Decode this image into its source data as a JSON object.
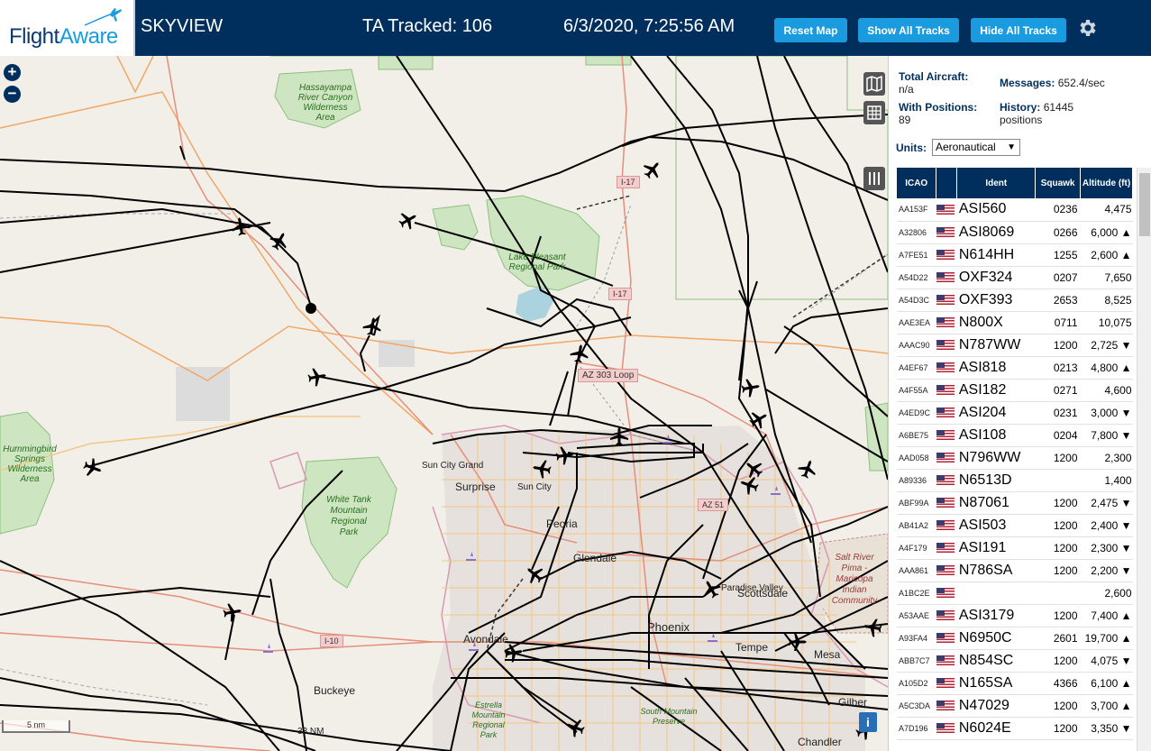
{
  "header": {
    "logo_flight": "Flight",
    "logo_aware": "Aware",
    "app_title": "SKYVIEW",
    "tracked": "TA Tracked: 106",
    "datetime": "6/3/2020, 7:25:56 AM",
    "reset_label": "Reset Map",
    "show_label": "Show All Tracks",
    "hide_label": "Hide All Tracks"
  },
  "colors": {
    "header_bg": "#002f5d",
    "button_bg": "#1a9be0",
    "park": "#cde6c1",
    "track": "#000000"
  },
  "map": {
    "zoom_in": "+",
    "zoom_out": "−",
    "scale_km": "5 nm",
    "scale_nm": "33 NM",
    "info": "i",
    "labels": [
      {
        "id": "hassayampa",
        "text": "Hassayampa River Canyon Wilderness Area"
      },
      {
        "id": "lake-pleasant",
        "text": "Lake Pleasant Regional Park"
      },
      {
        "id": "hummingbird",
        "text": "Hummingbird Springs Wilderness Area"
      },
      {
        "id": "white-tank",
        "text": "White Tank Mountain Regional Park"
      },
      {
        "id": "estrella",
        "text": "Estrella Mountain Regional Park"
      },
      {
        "id": "south-mountain",
        "text": "South Mountain Preserve"
      },
      {
        "id": "salt-river",
        "text": "Salt River Pima - Maricopa Indian Community"
      },
      {
        "id": "sun-city-grand",
        "text": "Sun City Grand"
      },
      {
        "id": "surprise",
        "text": "Surprise"
      },
      {
        "id": "sun-city",
        "text": "Sun City"
      },
      {
        "id": "peoria",
        "text": "Peoria"
      },
      {
        "id": "glendale",
        "text": "Glendale"
      },
      {
        "id": "paradise-valley",
        "text": "Paradise Valley"
      },
      {
        "id": "scottsdale",
        "text": "Scottsdale"
      },
      {
        "id": "phoenix",
        "text": "Phoenix"
      },
      {
        "id": "tempe",
        "text": "Tempe"
      },
      {
        "id": "mesa",
        "text": "Mesa"
      },
      {
        "id": "avondale",
        "text": "Avondale"
      },
      {
        "id": "buckeye",
        "text": "Buckeye"
      },
      {
        "id": "gilbert",
        "text": "Gilber"
      },
      {
        "id": "chandler",
        "text": "Chandler"
      },
      {
        "id": "i17",
        "text": "I-17"
      },
      {
        "id": "i17b",
        "text": "I-17"
      },
      {
        "id": "az303",
        "text": "AZ 303 Loop"
      },
      {
        "id": "az51",
        "text": "AZ 51"
      },
      {
        "id": "i10",
        "text": "I-10"
      }
    ]
  },
  "stats": {
    "total_label": "Total Aircraft:",
    "total_value": "n/a",
    "positions_label": "With Positions:",
    "positions_value": "89",
    "messages_label": "Messages:",
    "messages_value": "652.4/sec",
    "history_label": "History:",
    "history_value": "61445",
    "history_unit": "positions"
  },
  "units": {
    "label": "Units:",
    "selected": "Aeronautical"
  },
  "table": {
    "headers": {
      "icao": "ICAO",
      "ident": "Ident",
      "squawk": "Squawk",
      "altitude": "Altitude (ft)"
    },
    "rows": [
      {
        "icao": "AA153F",
        "ident": "ASI560",
        "squawk": "0236",
        "alt": "4,475"
      },
      {
        "icao": "A32806",
        "ident": "ASI8069",
        "squawk": "0266",
        "alt": "6,000 ▲"
      },
      {
        "icao": "A7FE51",
        "ident": "N614HH",
        "squawk": "1255",
        "alt": "2,600 ▲"
      },
      {
        "icao": "A54D22",
        "ident": "OXF324",
        "squawk": "0207",
        "alt": "7,650"
      },
      {
        "icao": "A54D3C",
        "ident": "OXF393",
        "squawk": "2653",
        "alt": "8,525"
      },
      {
        "icao": "AAE3EA",
        "ident": "N800X",
        "squawk": "0711",
        "alt": "10,075"
      },
      {
        "icao": "AAAC90",
        "ident": "N787WW",
        "squawk": "1200",
        "alt": "2,725 ▼"
      },
      {
        "icao": "A4EF67",
        "ident": "ASI818",
        "squawk": "0213",
        "alt": "4,800 ▲"
      },
      {
        "icao": "A4F55A",
        "ident": "ASI182",
        "squawk": "0271",
        "alt": "4,600"
      },
      {
        "icao": "A4ED9C",
        "ident": "ASI204",
        "squawk": "0231",
        "alt": "3,000 ▼"
      },
      {
        "icao": "A6BE75",
        "ident": "ASI108",
        "squawk": "0204",
        "alt": "7,800 ▼"
      },
      {
        "icao": "AAD058",
        "ident": "N796WW",
        "squawk": "1200",
        "alt": "2,300"
      },
      {
        "icao": "A89336",
        "ident": "N6513D",
        "squawk": "",
        "alt": "1,400"
      },
      {
        "icao": "ABF99A",
        "ident": "N87061",
        "squawk": "1200",
        "alt": "2,475 ▼"
      },
      {
        "icao": "AB41A2",
        "ident": "ASI503",
        "squawk": "1200",
        "alt": "2,400 ▼"
      },
      {
        "icao": "A4F179",
        "ident": "ASI191",
        "squawk": "1200",
        "alt": "2,300 ▼"
      },
      {
        "icao": "AAA861",
        "ident": "N786SA",
        "squawk": "1200",
        "alt": "2,200 ▼"
      },
      {
        "icao": "A1BC2E",
        "ident": "",
        "squawk": "",
        "alt": "2,600"
      },
      {
        "icao": "A53AAE",
        "ident": "ASI3179",
        "squawk": "1200",
        "alt": "7,400 ▲"
      },
      {
        "icao": "A93FA4",
        "ident": "N6950C",
        "squawk": "2601",
        "alt": "19,700 ▲"
      },
      {
        "icao": "ABB7C7",
        "ident": "N854SC",
        "squawk": "1200",
        "alt": "4,075 ▼"
      },
      {
        "icao": "A105D2",
        "ident": "N165SA",
        "squawk": "4366",
        "alt": "6,100 ▲"
      },
      {
        "icao": "A5C3DA",
        "ident": "N47029",
        "squawk": "1200",
        "alt": "3,700 ▲"
      },
      {
        "icao": "A7D196",
        "ident": "N6024E",
        "squawk": "1200",
        "alt": "3,350 ▼"
      }
    ]
  }
}
